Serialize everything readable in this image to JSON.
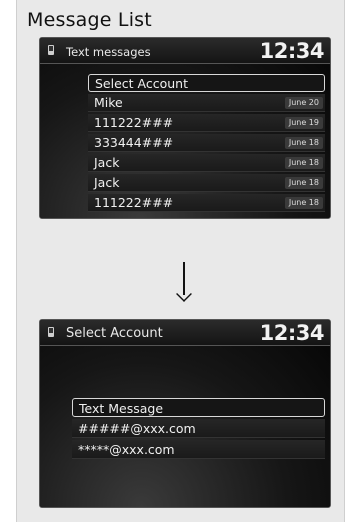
{
  "heading": "Message List",
  "screen1": {
    "title": "Text messages",
    "clock": "12:34",
    "rows": [
      {
        "label": "Select Account",
        "date": "",
        "selected": true
      },
      {
        "label": "Mike",
        "date": "June 20",
        "selected": false
      },
      {
        "label": "111222###",
        "date": "June 19",
        "selected": false
      },
      {
        "label": "333444###",
        "date": "June 18",
        "selected": false
      },
      {
        "label": "Jack",
        "date": "June 18",
        "selected": false
      },
      {
        "label": "Jack",
        "date": "June 18",
        "selected": false
      },
      {
        "label": "111222###",
        "date": "June 18",
        "selected": false
      }
    ]
  },
  "arrow": {
    "direction": "down"
  },
  "screen2": {
    "title": "Select Account",
    "clock": "12:34",
    "rows": [
      {
        "label": "Text Message",
        "selected": true
      },
      {
        "label": "#####@xxx.com",
        "selected": false
      },
      {
        "label": "*****@xxx.com",
        "selected": false
      }
    ]
  }
}
